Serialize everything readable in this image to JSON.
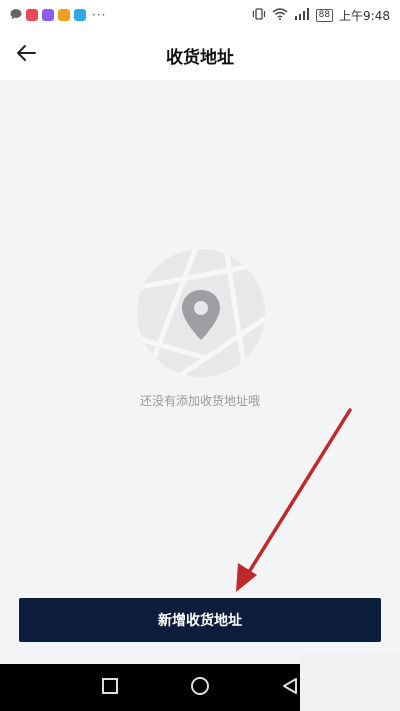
{
  "status_bar": {
    "time": "上午9:48",
    "battery": "88",
    "colors": {
      "app1": "#e94b5a",
      "app2": "#8a5cf0",
      "app3": "#f0a020",
      "app4": "#33a8e0"
    }
  },
  "header": {
    "title": "收货地址",
    "back_icon": "arrow-left-icon"
  },
  "empty_state": {
    "message": "还没有添加收货地址哦",
    "icon": "location-pin-icon"
  },
  "actions": {
    "add_address_label": "新增收货地址"
  },
  "annotation": {
    "color": "#c0282a"
  },
  "nav": {
    "recent_icon": "square-icon",
    "home_icon": "circle-icon",
    "back_icon": "triangle-back-icon"
  }
}
